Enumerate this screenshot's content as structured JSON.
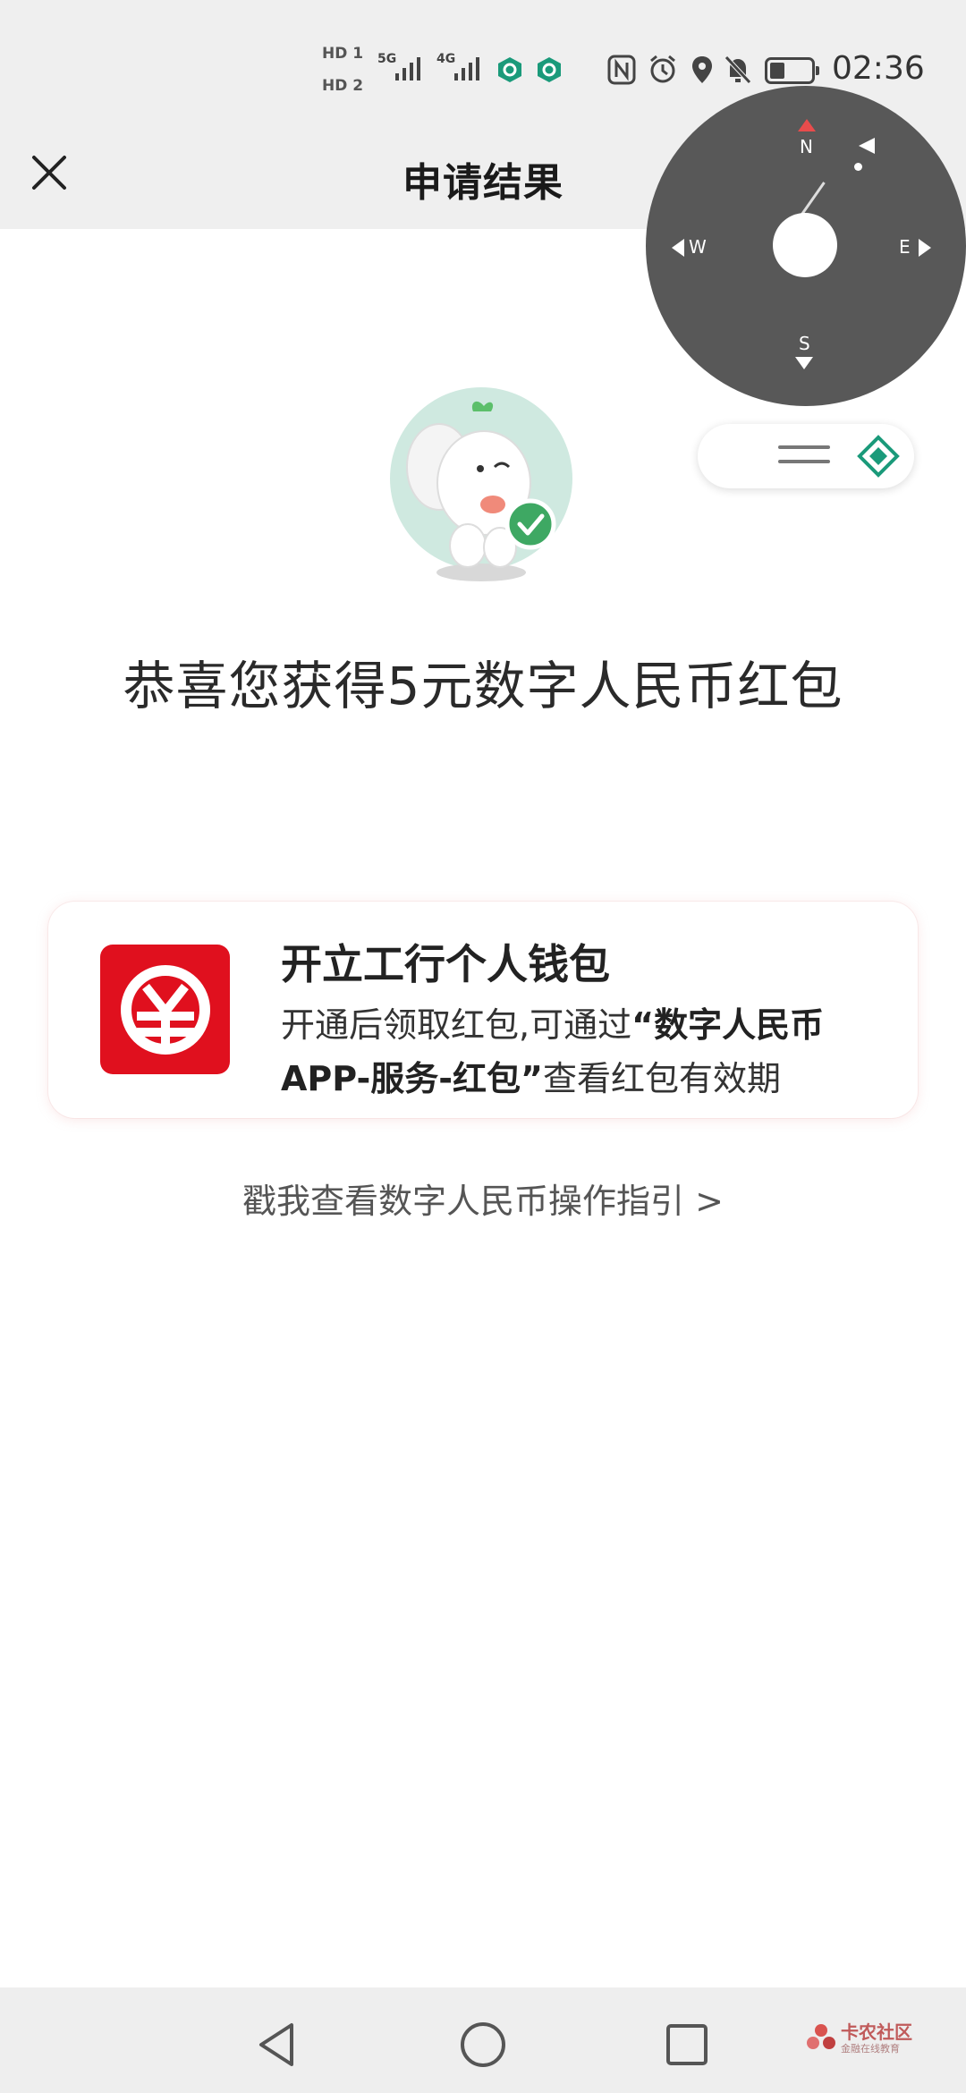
{
  "status_bar": {
    "sim1": "HD 1",
    "sim2": "HD 2",
    "net1": "5G",
    "net2": "4G",
    "time": "02:36",
    "icons": [
      "nfc-icon",
      "alarm-icon",
      "location-icon",
      "mute-icon",
      "battery-icon"
    ]
  },
  "header": {
    "title": "申请结果",
    "close_icon": "close-icon",
    "more_icon": "more-icon"
  },
  "result": {
    "message": "恭喜您获得5元数字人民币红包",
    "mascot_icon": "elephant-mascot-success"
  },
  "wallet_card": {
    "title": "开立工行个人钱包",
    "desc_prefix": "开通后领取红包,可通过",
    "desc_bold": "“数字人民币APP-服务-红包”",
    "desc_suffix": "查看红包有效期",
    "logo_icon": "e-cny-logo"
  },
  "guide_link": "戳我查看数字人民币操作指引 >",
  "compass": {
    "n": "N",
    "s": "S",
    "e": "E",
    "w": "W"
  },
  "nav": {
    "back_icon": "back-triangle-icon",
    "home_icon": "home-circle-icon",
    "recents_icon": "recents-square-icon"
  },
  "watermark": {
    "name": "卡农社区",
    "sub": "金融在线教育"
  },
  "colors": {
    "brand_red": "#e0101e",
    "header_bg": "#efefef",
    "accent_green": "#1a9a7a"
  }
}
